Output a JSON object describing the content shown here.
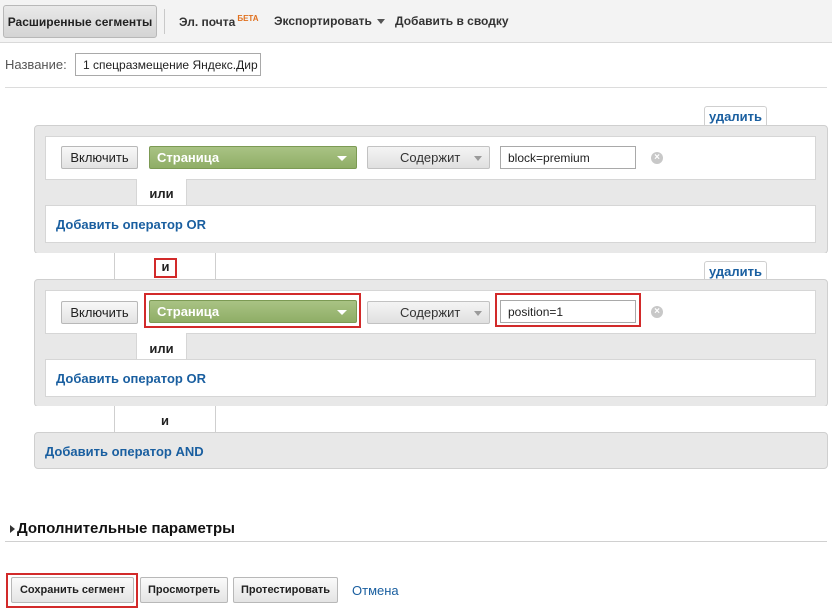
{
  "toolbar": {
    "active_tab": "Расширенные сегменты",
    "email": "Эл. почта",
    "email_badge": "БЕТА",
    "export": "Экспортировать",
    "add_to_summary": "Добавить в сводку"
  },
  "segment_name": {
    "label": "Название:",
    "value": "1 спецразмещение Яндекс.Дир"
  },
  "conditions": [
    {
      "delete_label": "удалить",
      "include_label": "Включить",
      "dimension": "Страница",
      "operator": "Содержит",
      "value": "block=premium",
      "or_connector": "или",
      "add_or_label": "Добавить оператор OR"
    },
    {
      "delete_label": "удалить",
      "include_label": "Включить",
      "dimension": "Страница",
      "operator": "Содержит",
      "value": "position=1",
      "or_connector": "или",
      "add_or_label": "Добавить оператор OR"
    }
  ],
  "and_connector": "и",
  "add_and_label": "Добавить оператор AND",
  "advanced_params": "Дополнительные параметры",
  "footer": {
    "save": "Сохранить сегмент",
    "preview": "Просмотреть",
    "test": "Протестировать",
    "cancel": "Отмена"
  },
  "colors": {
    "highlight": "#d22a2a",
    "dimension_green": "#97b46f",
    "link_blue": "#1a5fa0"
  }
}
